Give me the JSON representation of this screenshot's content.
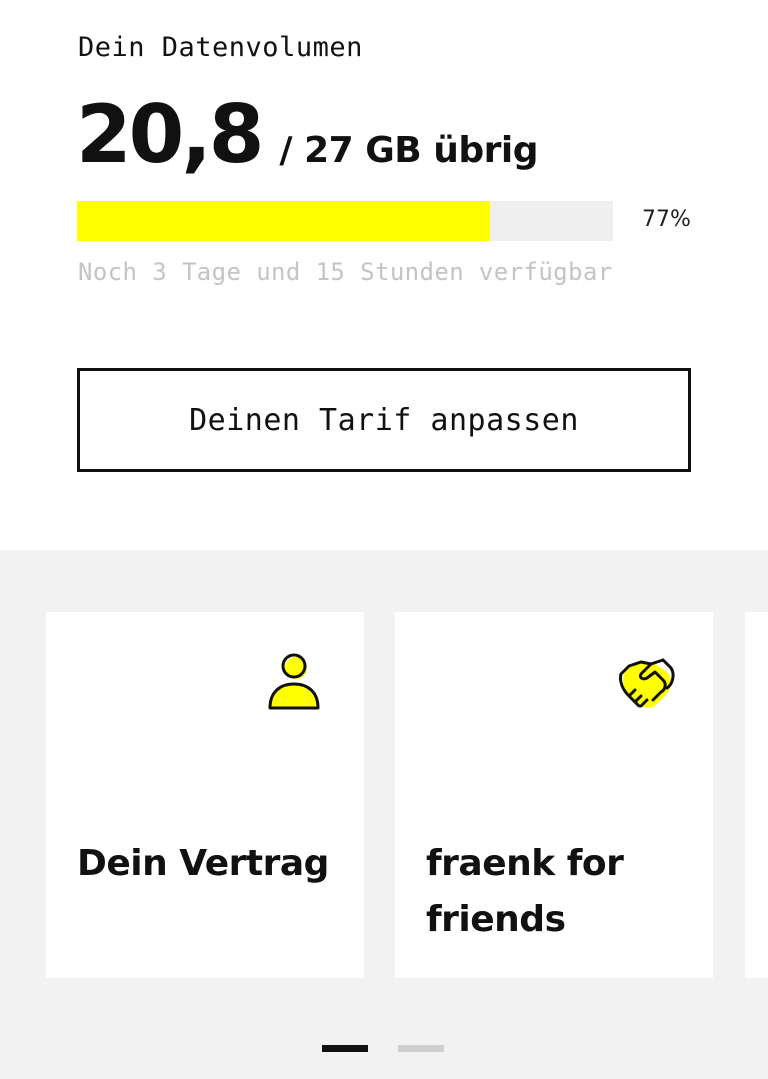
{
  "data_volume": {
    "label": "Dein Datenvolumen",
    "remaining": "20,8",
    "total_text": "/ 27 GB übrig",
    "progress_fraction": 0.77,
    "percent_label": "77%",
    "time_remaining": "Noch 3 Tage und 15 Stunden verfügbar"
  },
  "tariff_button": {
    "label": "Deinen Tarif anpassen"
  },
  "cards": [
    {
      "title": "Dein Vertrag",
      "icon": "person-icon"
    },
    {
      "title": "fraenk for friends",
      "icon": "handshake-icon"
    }
  ],
  "pager": {
    "pages": 2,
    "active": 0
  },
  "colors": {
    "accent": "#ffff00",
    "text": "#111111",
    "muted": "#c4c4c4",
    "background_grey": "#f2f2f2"
  }
}
